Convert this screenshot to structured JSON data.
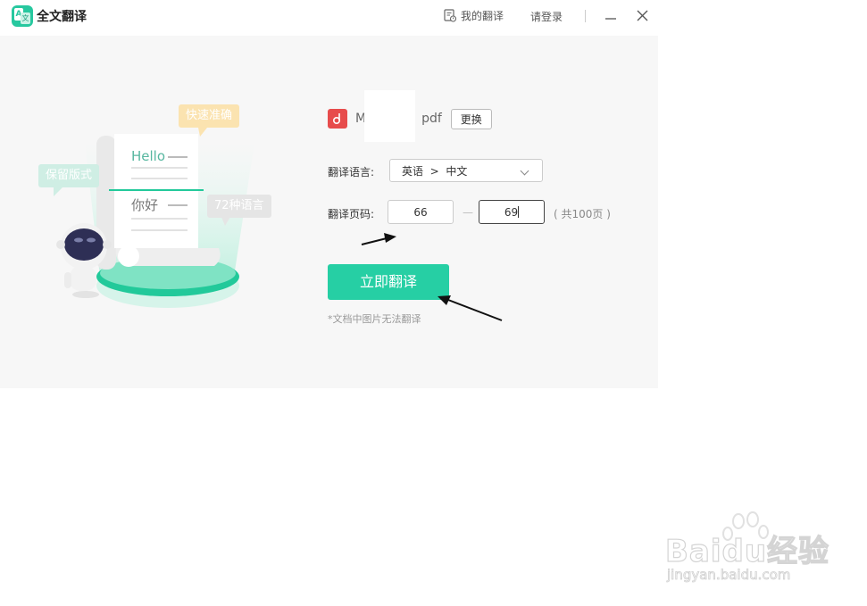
{
  "titlebar": {
    "app_title": "全文翻译",
    "my_translations": "我的翻译",
    "login": "请登录"
  },
  "illustration": {
    "bubble_fast": "快速准确",
    "bubble_layout": "保留版式",
    "bubble_langs": "72种语言",
    "doc_hello": "Hello",
    "doc_nihao": "你好"
  },
  "file": {
    "name_prefix": "M",
    "name_suffix": "pdf",
    "replace_label": "更换"
  },
  "form": {
    "language_label": "翻译语言:",
    "language_value": "英语  >  中文",
    "pages_label": "翻译页码:",
    "page_from": "66",
    "page_to": "69",
    "range_dash": "—",
    "total_pages": "( 共100页 )"
  },
  "translate_button": "立即翻译",
  "note": "*文档中图片无法翻译",
  "watermark": {
    "brand": "Baidu经验",
    "url": "jingyan.baidu.com"
  },
  "colors": {
    "accent": "#26cfa4",
    "pdf_red": "#e74c4c",
    "panel_bg": "#f7f7f7"
  },
  "icons": [
    "app-logo-icon",
    "history-icon",
    "minimize-icon",
    "close-icon",
    "pdf-icon",
    "chevron-down-icon",
    "robot-icon",
    "arrow-icon"
  ]
}
